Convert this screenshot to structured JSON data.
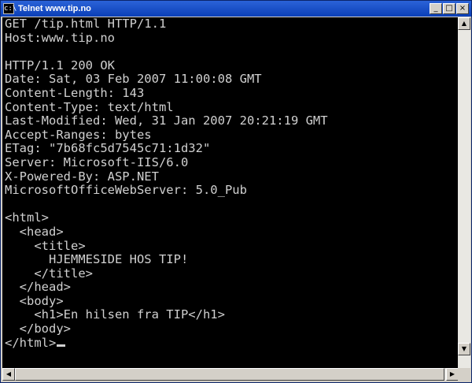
{
  "window": {
    "title": "Telnet www.tip.no",
    "app_icon": "console-icon",
    "controls": {
      "minimize": "_",
      "maximize": "□",
      "close": "×"
    }
  },
  "console": {
    "lines": [
      "GET /tip.html HTTP/1.1",
      "Host:www.tip.no",
      "",
      "HTTP/1.1 200 OK",
      "Date: Sat, 03 Feb 2007 11:00:08 GMT",
      "Content-Length: 143",
      "Content-Type: text/html",
      "Last-Modified: Wed, 31 Jan 2007 20:21:19 GMT",
      "Accept-Ranges: bytes",
      "ETag: \"7b68fc5d7545c71:1d32\"",
      "Server: Microsoft-IIS/6.0",
      "X-Powered-By: ASP.NET",
      "MicrosoftOfficeWebServer: 5.0_Pub",
      "",
      "<html>",
      "  <head>",
      "    <title>",
      "      HJEMMESIDE HOS TIP!",
      "    </title>",
      "  </head>",
      "  <body>",
      "    <h1>En hilsen fra TIP</h1>",
      "  </body>",
      "</html>"
    ]
  },
  "scrollbars": {
    "up_arrow": "▲",
    "down_arrow": "▼",
    "left_arrow": "◀",
    "right_arrow": "▶"
  }
}
